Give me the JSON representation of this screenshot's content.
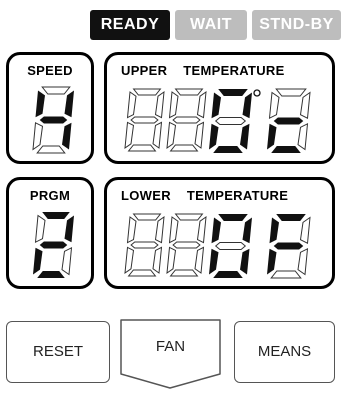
{
  "status": {
    "ready": "READY",
    "wait": "WAIT",
    "standby": "STND-BY"
  },
  "panels": {
    "speed": {
      "title": "SPEED",
      "value": "4"
    },
    "upper": {
      "title_1": "UPPER",
      "title_2": "TEMPERATURE",
      "value": "0c"
    },
    "prgm": {
      "title": "PRGM",
      "value": "2"
    },
    "lower": {
      "title_1": "LOWER",
      "title_2": "TEMPERATURE",
      "value": "0F"
    }
  },
  "buttons": {
    "reset": "RESET",
    "fan": "FAN",
    "means": "MEANS"
  },
  "colors": {
    "active": "#111111",
    "inactive": "#bdbdbd",
    "segment_off": "#333333"
  }
}
